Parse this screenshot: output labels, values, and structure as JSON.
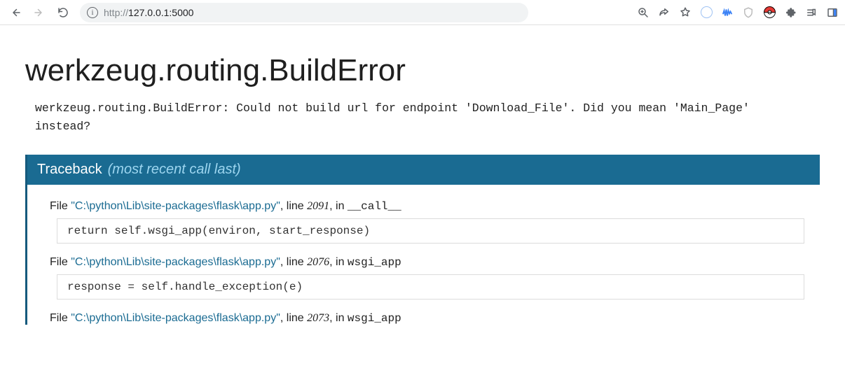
{
  "browser": {
    "url_scheme": "http://",
    "url_rest": "127.0.0.1:5000"
  },
  "error": {
    "title": "werkzeug.routing.BuildError",
    "message": "werkzeug.routing.BuildError: Could not build url for endpoint 'Download_File'. Did you mean 'Main_Page' instead?"
  },
  "traceback": {
    "heading": "Traceback",
    "subtitle": "(most recent call last)",
    "file_label": "File",
    "line_label": "line",
    "in_label": "in",
    "frames": [
      {
        "path": "\"C:\\python\\Lib\\site-packages\\flask\\app.py\"",
        "lineno": "2091",
        "funcname": "__call__",
        "code": "return self.wsgi_app(environ, start_response)"
      },
      {
        "path": "\"C:\\python\\Lib\\site-packages\\flask\\app.py\"",
        "lineno": "2076",
        "funcname": "wsgi_app",
        "code": "response = self.handle_exception(e)"
      },
      {
        "path": "\"C:\\python\\Lib\\site-packages\\flask\\app.py\"",
        "lineno": "2073",
        "funcname": "wsgi_app",
        "code": ""
      }
    ]
  }
}
